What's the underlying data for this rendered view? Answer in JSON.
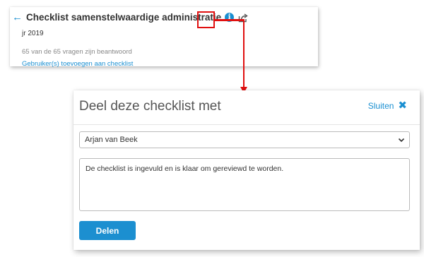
{
  "checklist": {
    "title": "Checklist samenstelwaardige administratie",
    "subtitle": "jr 2019",
    "count_text": "65 van de 65 vragen zijn beantwoord",
    "add_users_link": "Gebruiker(s) toevoegen aan checklist",
    "icons": {
      "back": "arrow-left-icon",
      "info": "info-icon",
      "share": "share-icon"
    }
  },
  "dialog": {
    "title": "Deel deze checklist met",
    "close_label": "Sluiten",
    "selected_user": "Arjan van Beek",
    "message": "De checklist is ingevuld en is klaar om gereviewd te worden.",
    "share_button": "Delen"
  },
  "colors": {
    "accent": "#1a8fd1",
    "annotation": "#e01010"
  }
}
